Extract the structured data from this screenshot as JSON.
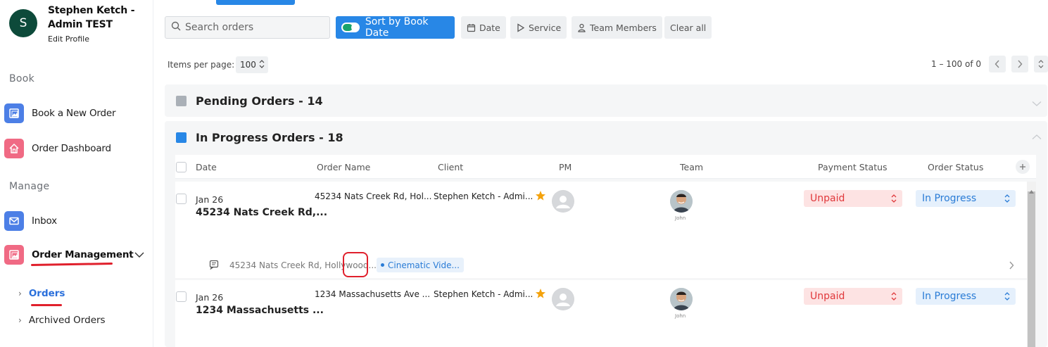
{
  "profile": {
    "initial": "S",
    "name": "Stephen Ketch - Admin TEST",
    "edit_label": "Edit Profile"
  },
  "sidebar": {
    "section_book": "Book",
    "section_manage": "Manage",
    "items": [
      {
        "label": "Book a New Order",
        "icon": "image-icon"
      },
      {
        "label": "Order Dashboard",
        "icon": "home-icon"
      },
      {
        "label": "Inbox",
        "icon": "mail-icon"
      },
      {
        "label": "Order Management",
        "icon": "image-icon"
      }
    ],
    "sub_items": [
      {
        "label": "Orders",
        "active": true
      },
      {
        "label": "Archived Orders",
        "active": false
      }
    ]
  },
  "toolbar": {
    "search_placeholder": "Search orders",
    "sort_label": "Sort by Book Date",
    "filters": [
      "Date",
      "Service",
      "Team Members",
      "Clear all"
    ]
  },
  "pagination": {
    "items_per_page_label": "Items per page:",
    "items_per_page_value": "100",
    "range_label": "1 – 100 of 0"
  },
  "groups": [
    {
      "title": "Pending Orders - 14",
      "color": "#aab0b7"
    },
    {
      "title": "In Progress Orders - 18",
      "color": "#2887e6"
    }
  ],
  "columns": [
    "Date",
    "Order Name",
    "Client",
    "PM",
    "Team",
    "Payment Status",
    "Order Status"
  ],
  "rows": [
    {
      "date": "Jan 26",
      "title": "45234 Nats Creek Rd,...",
      "order_name": "45234 Nats Creek Rd, Hol...",
      "client": "Stephen Ketch - Admi...",
      "team_name": "John",
      "payment_status": "Unpaid",
      "order_status": "In Progress",
      "notes_address": "45234 Nats Creek Rd, Hollywood...",
      "service_tag": "Cinematic Vide..."
    },
    {
      "date": "Jan 26",
      "title": "1234 Massachusetts ...",
      "order_name": "1234 Massachusetts Ave ...",
      "client": "Stephen Ketch - Admi...",
      "team_name": "John",
      "payment_status": "Unpaid",
      "order_status": "In Progress"
    }
  ],
  "colors": {
    "accent": "#2887e6",
    "unpaid_bg": "#fde3e3",
    "unpaid_text": "#e0383b",
    "progress_bg": "#e5f0fc",
    "star": "#f4a20c",
    "annotation": "#e0202c"
  }
}
